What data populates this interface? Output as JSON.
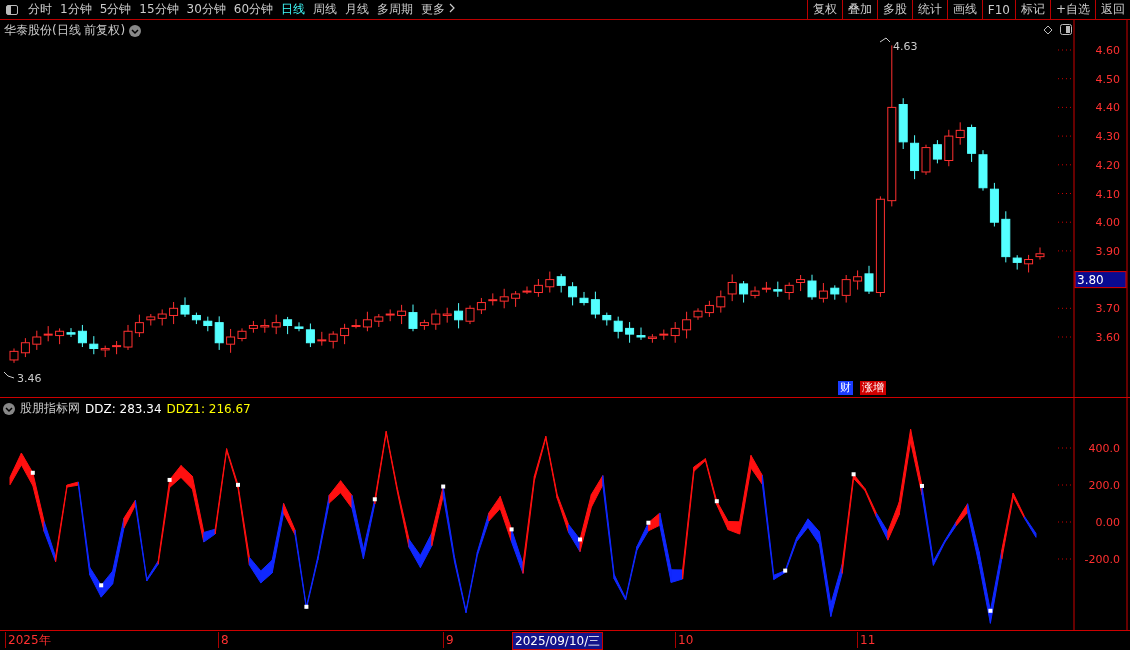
{
  "toolbar": {
    "periods": [
      {
        "label": "分时",
        "selected": false
      },
      {
        "label": "1分钟",
        "selected": false
      },
      {
        "label": "5分钟",
        "selected": false
      },
      {
        "label": "15分钟",
        "selected": false
      },
      {
        "label": "30分钟",
        "selected": false
      },
      {
        "label": "60分钟",
        "selected": false
      },
      {
        "label": "日线",
        "selected": true
      },
      {
        "label": "周线",
        "selected": false
      },
      {
        "label": "月线",
        "selected": false
      },
      {
        "label": "多周期",
        "selected": false
      }
    ],
    "more": "更多",
    "actions": [
      "复权",
      "叠加",
      "多股",
      "统计",
      "画线",
      "F10",
      "标记",
      "+自选",
      "返回"
    ]
  },
  "chart": {
    "title": "华泰股份(日线 前复权)",
    "price_ticks": [
      "4.60",
      "4.50",
      "4.40",
      "4.30",
      "4.20",
      "4.10",
      "4.00",
      "3.90",
      "3.70",
      "3.60"
    ],
    "current_price": "3.80",
    "high_label": "4.63",
    "low_label": "3.46",
    "event_tags": [
      {
        "label": "财",
        "kind": "finance"
      },
      {
        "label": "涨增",
        "kind": "increase"
      }
    ]
  },
  "indicator": {
    "name": "股朋指标网",
    "readouts": [
      {
        "label": "DDZ: 283.34",
        "color": "#ffffff"
      },
      {
        "label": "DDZ1: 216.67",
        "color": "#ffff00"
      }
    ],
    "ticks": [
      "400.0",
      "200.0",
      "0.00",
      "-200.0"
    ]
  },
  "date_axis": [
    {
      "label": "2025年",
      "selected": false
    },
    {
      "label": "8",
      "selected": false
    },
    {
      "label": "9",
      "selected": false
    },
    {
      "label": "2025/09/10/三",
      "selected": true
    },
    {
      "label": "10",
      "selected": false
    },
    {
      "label": "11",
      "selected": false
    }
  ]
}
